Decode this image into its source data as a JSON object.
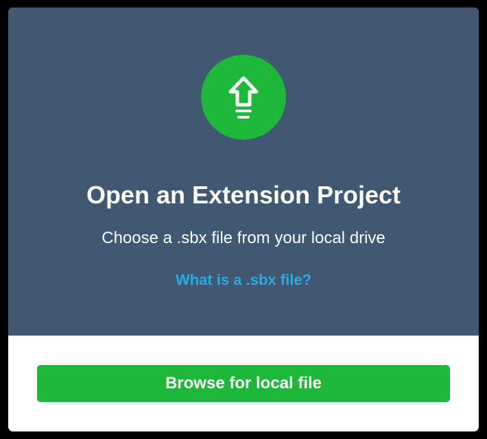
{
  "dialog": {
    "icon": "upload-arrow-icon",
    "title": "Open an Extension Project",
    "subtitle": "Choose a .sbx file from your local drive",
    "help_link": "What is a .sbx file?",
    "browse_button": "Browse for local file"
  },
  "colors": {
    "panel_background": "#405872",
    "accent_green": "#1db83a",
    "link_blue": "#2ba8e6",
    "text_white": "#ffffff"
  }
}
